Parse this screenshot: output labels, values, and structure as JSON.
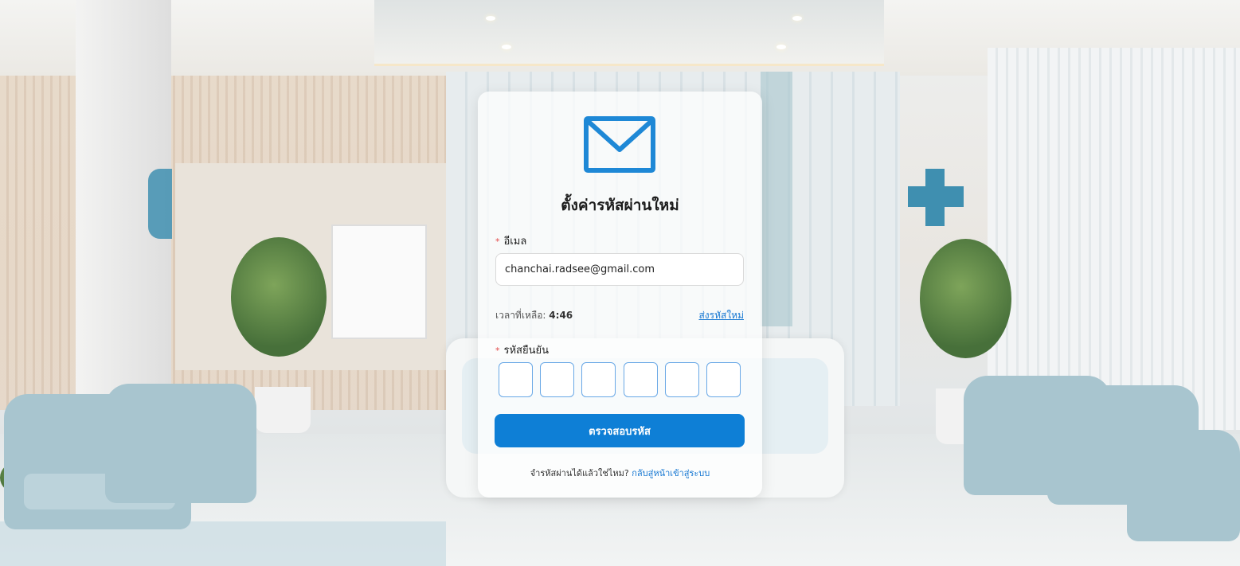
{
  "form": {
    "title": "ตั้งค่ารหัสผ่านใหม่",
    "required_mark": "*",
    "email_label": "อีเมล",
    "email_value": "chanchai.radsee@gmail.com",
    "timer_label": "เวลาที่เหลือ:",
    "timer_value": "4:46",
    "resend_label": "ส่งรหัสใหม่",
    "code_label": "รหัสยืนยัน",
    "code_digits": [
      "",
      "",
      "",
      "",
      "",
      ""
    ],
    "verify_button": "ตรวจสอบรหัส",
    "footer_text": "จำรหัสผ่านได้แล้วใช่ไหม?",
    "footer_link": "กลับสู่หน้าเข้าสู่ระบบ"
  },
  "icons": {
    "header": "mail-icon"
  },
  "colors": {
    "accent": "#0e7fd6",
    "link": "#1677d2",
    "required": "#e34b4b",
    "otp_border": "#69a8e6"
  }
}
